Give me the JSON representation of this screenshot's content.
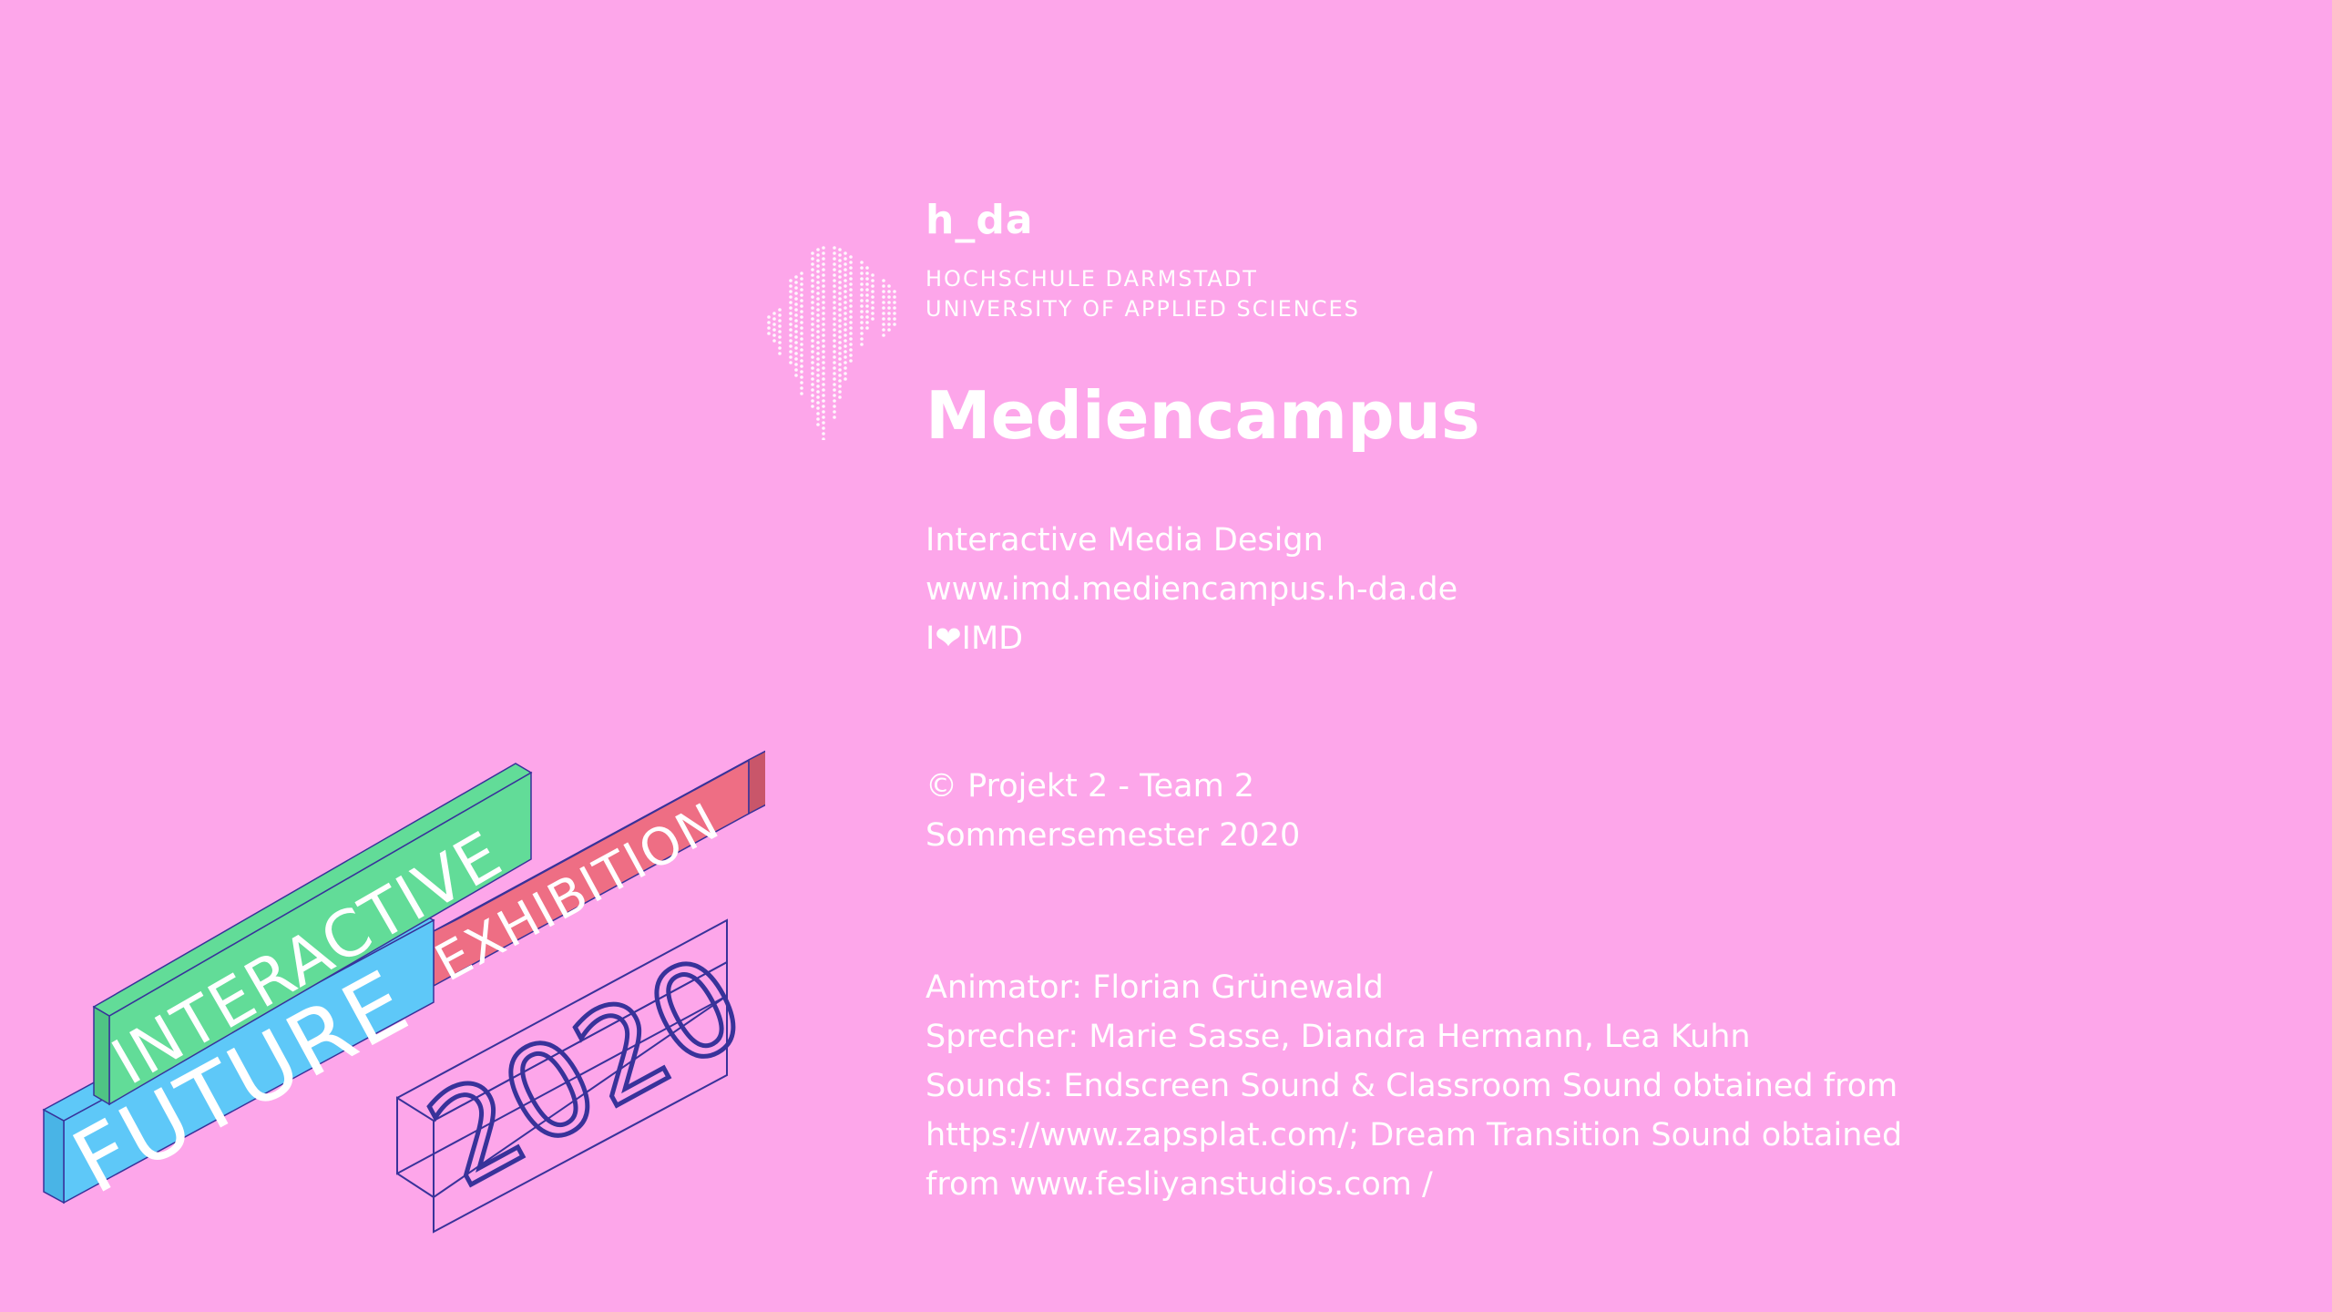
{
  "header": {
    "short_name": "h_da",
    "institution_line1": "HOCHSCHULE DARMSTADT",
    "institution_line2": "UNIVERSITY OF APPLIED SCIENCES",
    "department": "Mediencampus"
  },
  "program": {
    "name": "Interactive Media Design",
    "url": "www.imd.mediencampus.h-da.de",
    "slogan": "I❤IMD"
  },
  "copyright": {
    "project": "© Projekt 2 - Team 2",
    "semester": "Sommersemester 2020"
  },
  "credits": {
    "animator": "Animator: Florian Grünewald",
    "speakers": "Sprecher: Marie Sasse, Diandra Hermann, Lea Kuhn",
    "sounds_line1": "Sounds: Endscreen Sound & Classroom Sound obtained from",
    "sounds_line2": "https://www.zapsplat.com/; Dream Transition Sound obtained",
    "sounds_line3": "from www.fesliyanstudios.com /"
  },
  "event_logo": {
    "word1": "INTERACTIVE",
    "word2": "FUTURE",
    "word3": "EXHIBITION",
    "word4": "2020",
    "colors": {
      "background": "#fda6ea",
      "green": "#62dc98",
      "blue": "#5ec8f8",
      "red": "#ee6e84",
      "navy": "#38329a"
    }
  }
}
